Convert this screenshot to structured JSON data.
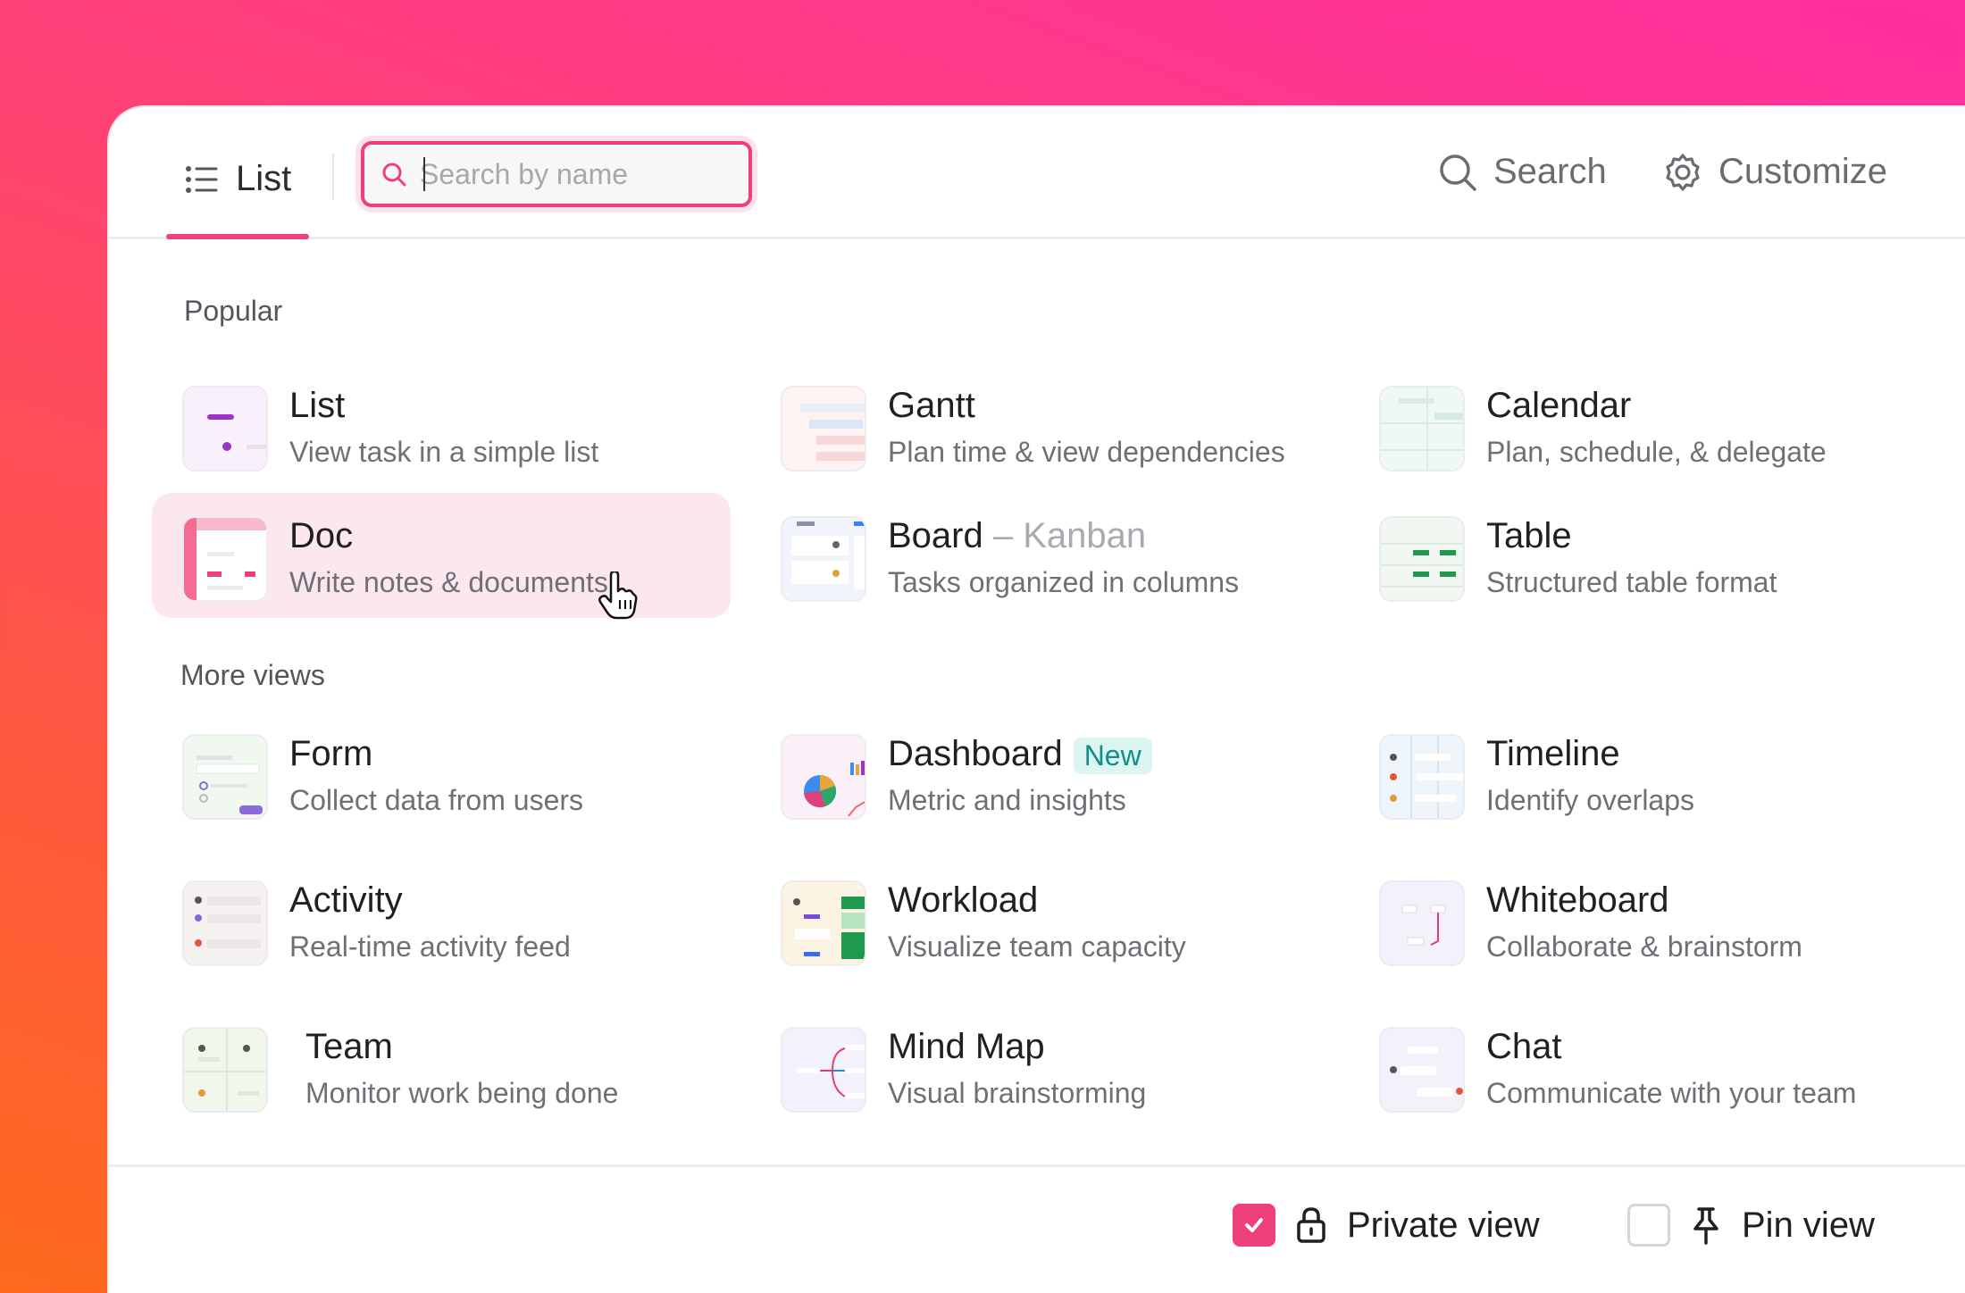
{
  "header": {
    "tab_label": "List",
    "search_placeholder": "Search by name",
    "search_label": "Search",
    "customize_label": "Customize"
  },
  "sections": {
    "popular": "Popular",
    "more": "More views"
  },
  "popular_items": [
    {
      "title": "List",
      "desc": "View task in a simple list"
    },
    {
      "title": "Gantt",
      "desc": "Plan time & view dependencies"
    },
    {
      "title": "Calendar",
      "desc": "Plan, schedule, & delegate"
    },
    {
      "title": "Doc",
      "desc": "Write notes & documents"
    },
    {
      "title": "Board",
      "subtitle": "– Kanban",
      "desc": "Tasks organized in columns"
    },
    {
      "title": "Table",
      "desc": "Structured table format"
    }
  ],
  "more_items": [
    {
      "title": "Form",
      "desc": "Collect data from users"
    },
    {
      "title": "Dashboard",
      "badge": "New",
      "desc": "Metric and insights"
    },
    {
      "title": "Timeline",
      "desc": "Identify overlaps"
    },
    {
      "title": "Activity",
      "desc": "Real-time activity feed"
    },
    {
      "title": "Workload",
      "desc": "Visualize team capacity"
    },
    {
      "title": "Whiteboard",
      "desc": "Collaborate & brainstorm"
    },
    {
      "title": "Team",
      "desc": "Monitor work being done"
    },
    {
      "title": "Mind Map",
      "desc": "Visual brainstorming"
    },
    {
      "title": "Chat",
      "desc": "Communicate with your team"
    }
  ],
  "footer": {
    "private_label": "Private view",
    "private_checked": true,
    "pin_label": "Pin view",
    "pin_checked": false
  },
  "colors": {
    "accent": "#ef3f7d",
    "highlight": "#fde7ef",
    "badge_text": "#0f8f86",
    "badge_bg": "#ddf5f2"
  },
  "icons": {
    "tab": "list-icon",
    "search": "search-icon",
    "customize": "gear-icon",
    "private": "lock-icon",
    "pin": "pin-icon"
  }
}
